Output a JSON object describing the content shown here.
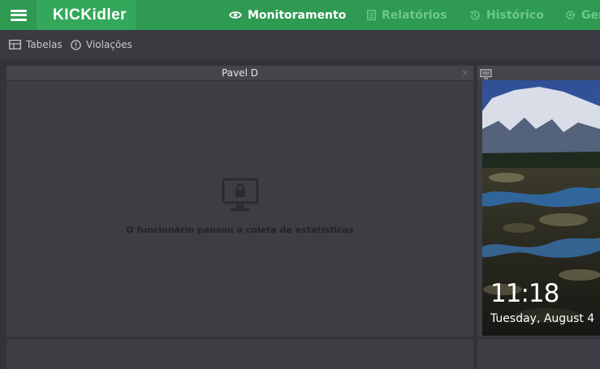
{
  "app": {
    "logo_text": "KICKidler"
  },
  "topnav": {
    "items": [
      {
        "label": "Monitoramento",
        "icon": "eye-icon",
        "active": true
      },
      {
        "label": "Relatórios",
        "icon": "document-icon",
        "active": false
      },
      {
        "label": "Histórico",
        "icon": "history-icon",
        "active": false
      },
      {
        "label": "Ger",
        "icon": "settings-icon",
        "active": false
      }
    ]
  },
  "toolbar": {
    "tables_label": "Tabelas",
    "violations_label": "Violações"
  },
  "panel": {
    "title": "Pavel D",
    "close_symbol": "×",
    "message": "O funcionário pausou a coleta de estatísticas",
    "status_icon": "locked-monitor-icon"
  },
  "right_panel": {
    "title": "",
    "screenshot": {
      "time": "11:18",
      "date": "Tuesday, August 4"
    }
  },
  "colors": {
    "topbar": "#2e9a52",
    "logo_bg": "#34a85a",
    "nav_inactive": "#6cc98c",
    "background": "#33343a",
    "panel": "#3d3e44"
  }
}
